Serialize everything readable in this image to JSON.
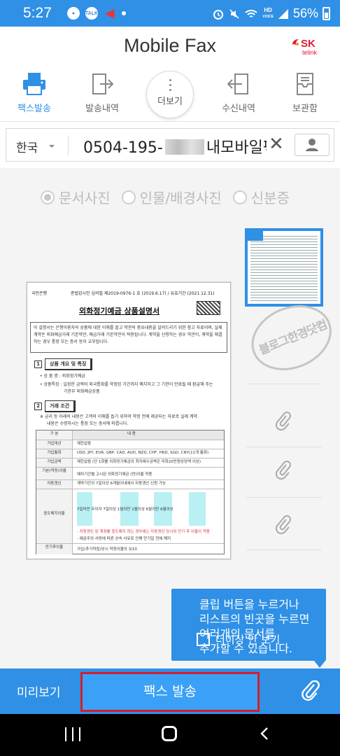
{
  "status_bar": {
    "time": "5:27",
    "notif_talk": "TALK",
    "network_hd": "HD",
    "network_voice": "VOICE",
    "battery": "56%"
  },
  "header": {
    "title": "Mobile Fax",
    "logo_sk": "SK",
    "logo_telink": "telink"
  },
  "tabs": [
    {
      "label": "팩스발송",
      "icon": "printer-icon",
      "active": true
    },
    {
      "label": "발송내역",
      "icon": "outbox-icon",
      "active": false
    },
    {
      "label": "더보기",
      "icon": "more-icon",
      "active": false
    },
    {
      "label": "수신내역",
      "icon": "inbox-icon",
      "active": false
    },
    {
      "label": "보관함",
      "icon": "storage-icon",
      "active": false
    }
  ],
  "recipient": {
    "country": "한국",
    "number_prefix": "0504-195-",
    "number_suffix": "내모바일팩스",
    "clear": "✕"
  },
  "doc_type_options": [
    {
      "label": "문서사진",
      "selected": true
    },
    {
      "label": "인물/배경사진",
      "selected": false
    },
    {
      "label": "신분증",
      "selected": false
    }
  ],
  "document": {
    "bank": "국민은행",
    "reg": "준법감시인 심의필 제2019-0976-1 호 (2019.6.17) / 유효기간 (2021.12.31)",
    "title": "외화정기예금 상품설명서",
    "intro": "이 설명서는 은행이용자의 상품에 대한 이해를 돕고 약관의 중요내용을 알려드리기 위한 참고 자료이며, 실제 계약은 외화예금거래 기본약관, 예금거래 기본약관이 적용됩니다. 계약을 신청하는 경우 약관이, 계약을 체결하는 경우 통장 또는 증서 등이 교부됩니다.",
    "sec1_num": "1",
    "sec1_title": "상품 개요 및 특징",
    "sec1_line1": "• 상 품 명 : 외화정기예금",
    "sec1_line2": "• 상품특징 : 일정한 금액의 외국통화를 약정된 기간까지 예치하고 그 기한이 만료될 때 환급해 주는",
    "sec1_line3": "기한부 외화예금상품",
    "sec2_num": "2",
    "sec2_title": "거래 조건",
    "sec2_line1": "※ 금리 등 아래의 내용은 고객의 이해를 돕기 위하여 약정 전에 제공되는 자료로 실제 계약",
    "sec2_line2": "내용은 수령하시는 통장 또는 증서에 따릅니다.",
    "table_rows": [
      {
        "k": "구 분",
        "v": "내 용"
      },
      {
        "k": "가입대상",
        "v": "제한없음"
      },
      {
        "k": "가입통화",
        "v": "USD, JPY, EUR, GBP, CAD, AUD, NZD, CHF, HKD, SGD, CNY(11개 통화)"
      },
      {
        "k": "가입금액",
        "v": "제한없음 (단 1회를 외화정기예금의 최저예수금액은 미화20만원상당액 이상)"
      },
      {
        "k": "기본(약정)이율",
        "v": "예치기간별 고시된 외화정기예금 (연)이율 적용"
      },
      {
        "k": "자동갱신",
        "v": "계약기간이 7일이상 6개월이내에서 자동갱신 신청 가능"
      },
      {
        "k": "중도해지이율",
        "v": "7일미만  무이자  7일이상 1월이만  1월이상 6월이만  6월이상"
      },
      {
        "k": "",
        "v": "- 자동갱신 된 계좌를 중도해지 하는 경우에는 자동갱신 당시와 만기 후 이율이 적용"
      },
      {
        "k": "",
        "v": "- 예금주의 사망에 따른 상속 사유로 인해 만기일 전에 해지"
      },
      {
        "k": "만기후이율",
        "v": "가입(추가적립)당시 약정이율의 3/10"
      }
    ],
    "red_note": "자동갱신 당시와 만기 후 이율이 적용"
  },
  "watermark_text": "블로그한경닷컴",
  "tooltip": {
    "message": "클립 버튼을 누르거나\n리스트의 빈곳을 누르면\n여러개의 문서를\n추가할 수 있습니다.",
    "checkbox_label": "더이상 안 보기"
  },
  "bottom_bar": {
    "preview": "미리보기",
    "send": "팩스 발송"
  }
}
